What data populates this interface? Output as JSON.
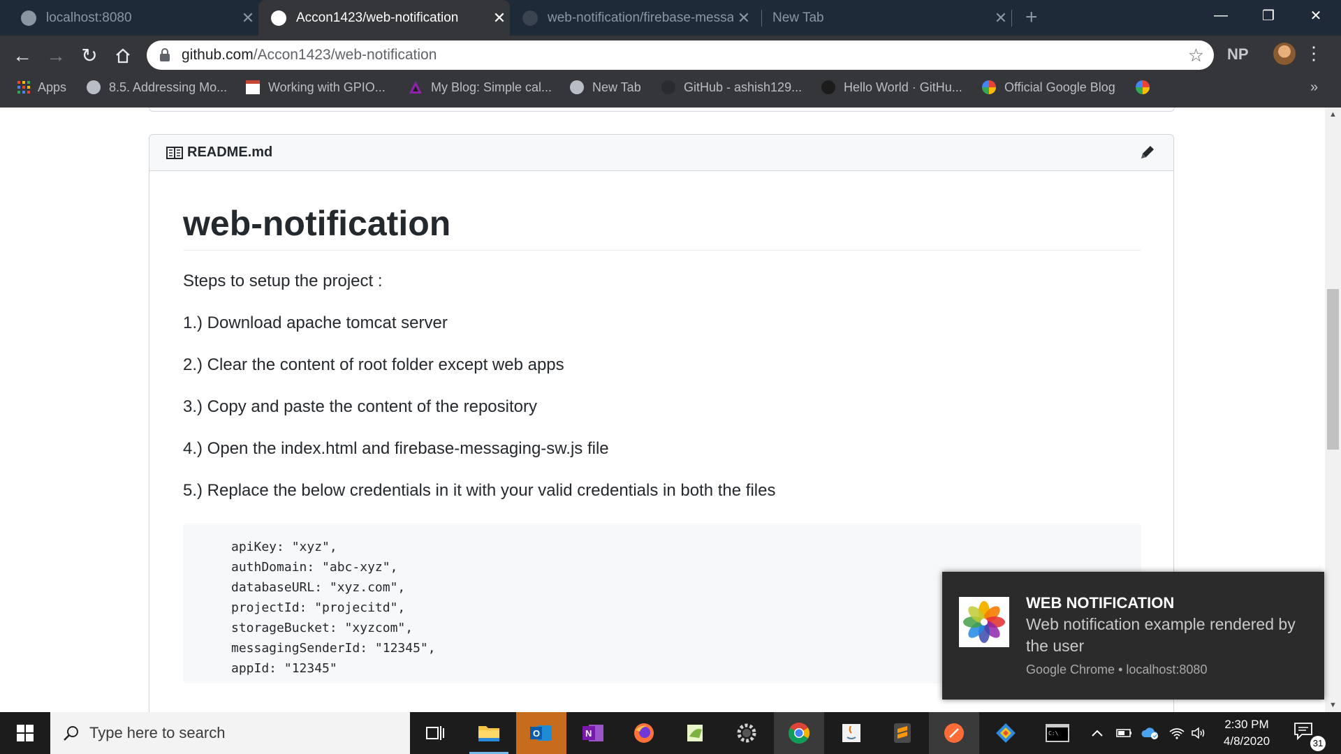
{
  "browser": {
    "tabs": [
      {
        "title": "localhost:8080",
        "active": false
      },
      {
        "title": "Accon1423/web-notification",
        "active": true
      },
      {
        "title": "web-notification/firebase-messa",
        "active": false
      },
      {
        "title": "New Tab",
        "active": false
      }
    ],
    "address": {
      "host": "github.com",
      "path": "/Accon1423/web-notification"
    },
    "profile_initials": "NP",
    "bookmarks": [
      {
        "label": "Apps",
        "icon": "apps-grid-icon"
      },
      {
        "label": "8.5. Addressing Mo...",
        "icon": "globe-icon"
      },
      {
        "label": "Working with GPIO...",
        "icon": "oracle-icon"
      },
      {
        "label": "My Blog: Simple cal...",
        "icon": "blog-icon"
      },
      {
        "label": "New Tab",
        "icon": "globe-icon"
      },
      {
        "label": "GitHub - ashish129...",
        "icon": "github-icon"
      },
      {
        "label": "Hello World · GitHu...",
        "icon": "github-icon"
      },
      {
        "label": "Official Google Blog",
        "icon": "google-icon"
      },
      {
        "label": "",
        "icon": "google-icon"
      }
    ]
  },
  "readme": {
    "filename": "README.md",
    "heading": "web-notification",
    "paragraphs": [
      "Steps to setup the project :",
      "1.) Download apache tomcat server",
      "2.) Clear the content of root folder except web apps",
      "3.) Copy and paste the content of the repository",
      "4.) Open the index.html and firebase-messaging-sw.js file",
      "5.) Replace the below credentials in it with your valid credentials in both the files"
    ],
    "code_lines": [
      "apiKey: \"xyz\",",
      "authDomain: \"abc-xyz\",",
      "databaseURL: \"xyz.com\",",
      "projectId: \"projecitd\",",
      "storageBucket: \"xyzcom\",",
      "messagingSenderId: \"12345\",",
      "appId: \"12345\""
    ]
  },
  "notification": {
    "title": "WEB NOTIFICATION",
    "body": "Web notification example rendered by the user",
    "source": "Google Chrome • localhost:8080"
  },
  "taskbar": {
    "search_placeholder": "Type here to search",
    "time": "2:30 PM",
    "date": "4/8/2020",
    "notifications_count": "31"
  }
}
